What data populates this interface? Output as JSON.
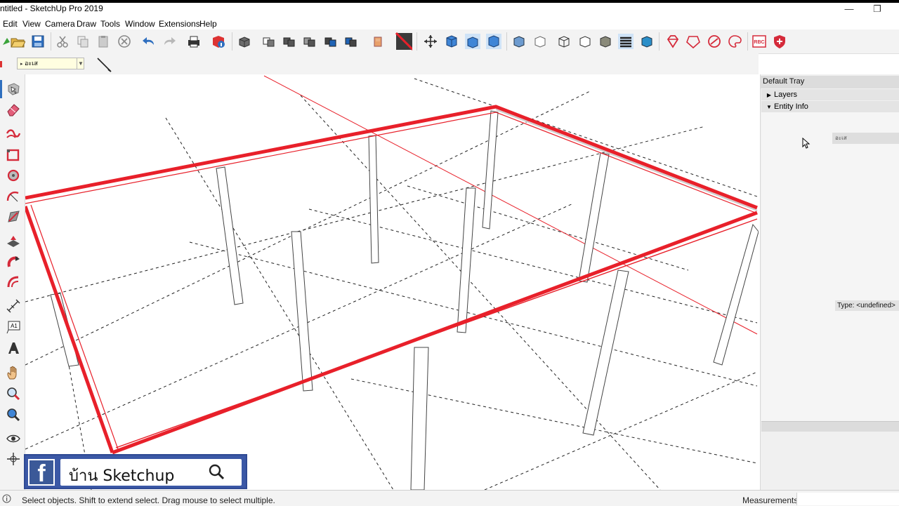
{
  "window": {
    "title": "ntitled - SketchUp Pro 2019",
    "minimize_glyph": "—",
    "restore_glyph": "❐"
  },
  "menu": [
    "Edit",
    "View",
    "Camera",
    "Draw",
    "Tools",
    "Window",
    "Extensions",
    "Help"
  ],
  "toolbar": {
    "icons": [
      "open-icon",
      "save-icon",
      "cut-icon",
      "copy-icon",
      "paste-icon",
      "erase-icon",
      "undo-icon",
      "redo-icon",
      "print-icon",
      "model-info-icon",
      "component-icon",
      "group-icon",
      "solid-outer-shell-icon",
      "solid-union-icon",
      "solid-subtract-icon",
      "paint-icon",
      "section-icon",
      "axes-icon",
      "iso-view-icon",
      "top-view-icon",
      "front-view-icon",
      "xray-icon",
      "wireframe-icon",
      "hidden-line-icon",
      "shaded-icon",
      "textured-icon",
      "monochrome-icon",
      "ruby-icon",
      "extension-warehouse-icon",
      "sketchup-gem-icon",
      "paint-palette-icon",
      "rbc-icon",
      "shield-icon"
    ]
  },
  "layer_toolbar": {
    "current_layer": "อะเส"
  },
  "left_toolbar": {
    "icons": [
      "select-icon",
      "eraser-icon",
      "freehand-icon",
      "rectangle-icon",
      "circle-icon",
      "arc-icon",
      "polygon-icon",
      "push-pull-icon",
      "follow-me-icon",
      "offset-icon",
      "tape-measure-icon",
      "text-icon",
      "3d-text-icon",
      "pan-icon",
      "zoom-icon",
      "zoom-extents-icon",
      "look-around-icon",
      "walk-icon"
    ]
  },
  "tray": {
    "title": "Default Tray",
    "panels": [
      {
        "label": "Layers",
        "expanded": false
      },
      {
        "label": "Entity Info",
        "expanded": true
      }
    ],
    "entity_info": {
      "layer": "อะเส",
      "type": "Type: <undefined>"
    }
  },
  "status": {
    "hint": "Select objects. Shift to extend select. Drag mouse to select multiple.",
    "measurements_label": "Measurements"
  },
  "watermark": {
    "logo_letter": "f",
    "text": "บ้าน Sketchup"
  },
  "colors": {
    "selection_red": "#e8202a",
    "facebook_blue": "#3b5998"
  }
}
